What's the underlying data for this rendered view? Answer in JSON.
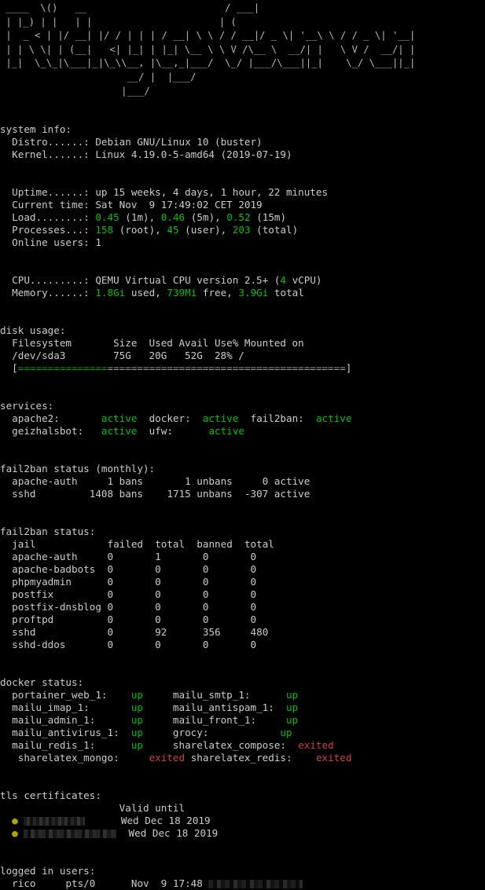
{
  "banner": {
    "name": "rickys-server-ascii-banner",
    "lines": [
      " ____  \\()   __                        / ___|",
      " | |_) | |   | |                      | (",
      " |  _ < | |/ __| |/ / | | | / __| \\ \\ / / __|/ _ \\| '__\\ \\ / / _ \\| '__|",
      " | | \\ \\| | (__|   <| |_| | |_| \\__ \\ \\ V /\\__ \\  __/| |   \\ V /  __/| |",
      " |_|  \\_\\_|\\___|_|\\_\\\\__, |\\__,_|___/  \\_/ |___/\\___||_|    \\_/ \\___||_|",
      "                      __/ |  |___/",
      "                     |___/"
    ]
  },
  "system_info": {
    "heading": "system info:",
    "rows": [
      {
        "label": "Distro......:",
        "value": "Debian GNU/Linux 10 (buster)"
      },
      {
        "label": "Kernel......:",
        "value": "Linux 4.19.0-5-amd64 (2019-07-19)"
      }
    ],
    "uptime": {
      "label": "Uptime......:",
      "value": "up 15 weeks, 4 days, 1 hour, 22 minutes"
    },
    "current_time": {
      "label": "Current time:",
      "value": "Sat Nov  9 17:49:02 CET 2019"
    },
    "load": {
      "label": "Load........:",
      "v1": "0.45",
      "t1": "(1m),",
      "v2": "0.46",
      "t2": "(5m),",
      "v3": "0.52",
      "t3": "(15m)"
    },
    "processes": {
      "label": "Processes...:",
      "v1": "158",
      "t1": "(root),",
      "v2": "45",
      "t2": "(user),",
      "v3": "203",
      "t3": "(total)"
    },
    "online_users": {
      "label": "Online users:",
      "value": "1"
    },
    "cpu": {
      "label": "CPU.........:",
      "pre": "QEMU Virtual CPU version 2.5+ (",
      "count": "4",
      "post": " vCPU)"
    },
    "memory": {
      "label": "Memory......:",
      "used": "1.8Gi",
      "used_txt": "used,",
      "free": "739Mi",
      "free_txt": "free,",
      "total": "3.9Gi",
      "total_txt": "total"
    }
  },
  "disk_usage": {
    "heading": "disk usage:",
    "header": "Filesystem       Size  Used Avail Use% Mounted on",
    "row": "/dev/sda3        75G   20G   52G  28% /",
    "bar": {
      "filled_chars": 15,
      "empty_chars": 40,
      "percent": "28%",
      "filled": "===============",
      "empty": "========================================"
    }
  },
  "services": {
    "heading": "services:",
    "line1": [
      {
        "name": "apache2:",
        "pad": "       ",
        "status": "active",
        "state": "active"
      },
      {
        "name": "docker:",
        "pad": "  ",
        "status": "active",
        "state": "active"
      },
      {
        "name": "fail2ban:",
        "pad": "  ",
        "status": "active",
        "state": "active"
      }
    ],
    "line2": [
      {
        "name": "geizhalsbot:",
        "pad": "   ",
        "status": "active",
        "state": "active"
      },
      {
        "name": "ufw:",
        "pad": "      ",
        "status": "active",
        "state": "active"
      }
    ]
  },
  "fail2ban_monthly": {
    "heading": "fail2ban status (monthly):",
    "rows": [
      {
        "jail": "apache-auth",
        "bans": "1 bans",
        "unbans": "1 unbans",
        "active": "0 active"
      },
      {
        "jail": "sshd",
        "bans": "1408 bans",
        "unbans": "1715 unbans",
        "active": "-307 active"
      }
    ]
  },
  "fail2ban_status": {
    "heading": "fail2ban status:",
    "columns": [
      "jail",
      "failed",
      "total",
      "banned",
      "total"
    ],
    "rows": [
      {
        "jail": "apache-auth",
        "failed": "0",
        "failed_total": "1",
        "banned": "0",
        "banned_total": "0"
      },
      {
        "jail": "apache-badbots",
        "failed": "0",
        "failed_total": "0",
        "banned": "0",
        "banned_total": "0"
      },
      {
        "jail": "phpmyadmin",
        "failed": "0",
        "failed_total": "0",
        "banned": "0",
        "banned_total": "0"
      },
      {
        "jail": "postfix",
        "failed": "0",
        "failed_total": "0",
        "banned": "0",
        "banned_total": "0"
      },
      {
        "jail": "postfix-dnsblog",
        "failed": "0",
        "failed_total": "0",
        "banned": "0",
        "banned_total": "0"
      },
      {
        "jail": "proftpd",
        "failed": "0",
        "failed_total": "0",
        "banned": "0",
        "banned_total": "0"
      },
      {
        "jail": "sshd",
        "failed": "0",
        "failed_total": "92",
        "banned": "356",
        "banned_total": "480"
      },
      {
        "jail": "sshd-ddos",
        "failed": "0",
        "failed_total": "0",
        "banned": "0",
        "banned_total": "0"
      }
    ]
  },
  "docker_status": {
    "heading": "docker status:",
    "rows": [
      {
        "left_name": "portainer_web_1:",
        "left_status": "up",
        "left_state": "up",
        "right_name": "mailu_smtp_1:",
        "right_status": "up",
        "right_state": "up"
      },
      {
        "left_name": "mailu_imap_1:",
        "left_status": "up",
        "left_state": "up",
        "right_name": "mailu_antispam_1:",
        "right_status": "up",
        "right_state": "up"
      },
      {
        "left_name": "mailu_admin_1:",
        "left_status": "up",
        "left_state": "up",
        "right_name": "mailu_front_1:",
        "right_status": "up",
        "right_state": "up"
      },
      {
        "left_name": "mailu_antivirus_1:",
        "left_status": "up",
        "left_state": "up",
        "right_name": "grocy:",
        "right_status": "up",
        "right_state": "up"
      },
      {
        "left_name": "mailu_redis_1:",
        "left_status": "up",
        "left_state": "up",
        "right_name": "sharelatex_compose:",
        "right_status": "exited",
        "right_state": "exited"
      },
      {
        "left_name": "sharelatex_mongo:",
        "left_status": "exited",
        "left_state": "exited",
        "right_name": "sharelatex_redis:",
        "right_status": "exited",
        "right_state": "exited"
      }
    ]
  },
  "tls_certificates": {
    "heading": "tls certificates:",
    "column_header": "Valid until",
    "rows": [
      {
        "bullet": "●",
        "domain_redacted": true,
        "domain_width": 78,
        "valid_until": "Wed Dec 18 2019"
      },
      {
        "bullet": "●",
        "domain_redacted": true,
        "domain_width": 118,
        "valid_until": "Wed Dec 18 2019"
      }
    ]
  },
  "logged_in_users": {
    "heading": "logged in users:",
    "rows": [
      {
        "user": "rico",
        "tty": "pts/0",
        "login_time": "Nov  9 17:48",
        "host_redacted": true,
        "host_width": 120
      }
    ]
  },
  "colors": {
    "background": "#000000",
    "foreground": "#cccccc",
    "green": "#00c000",
    "red": "#cf4040",
    "yellow": "#b0a800"
  }
}
